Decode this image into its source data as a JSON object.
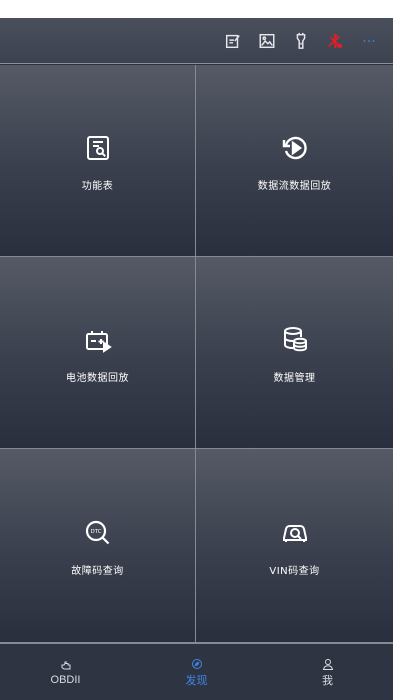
{
  "toolbar": {
    "icons": [
      "edit-note-icon",
      "image-icon",
      "flashlight-icon",
      "bluetooth-off-icon",
      "more-icon"
    ],
    "colors": {
      "bluetooth_off": "#e21f26",
      "more": "#3f86e8"
    }
  },
  "tiles": [
    {
      "label": "功能表",
      "icon": "function-list-icon"
    },
    {
      "label": "数据流数据回放",
      "icon": "replay-icon"
    },
    {
      "label": "电池数据回放",
      "icon": "battery-replay-icon"
    },
    {
      "label": "数据管理",
      "icon": "database-icon"
    },
    {
      "label": "故障码查询",
      "icon": "dtc-search-icon"
    },
    {
      "label": "VIN码查询",
      "icon": "vin-search-icon"
    }
  ],
  "bottom_nav": [
    {
      "label": "OBDII",
      "icon": "engine-icon",
      "active": false
    },
    {
      "label": "发现",
      "icon": "discover-icon",
      "active": true
    },
    {
      "label": "我",
      "icon": "user-icon",
      "active": false
    }
  ],
  "colors": {
    "accent": "#3f86e8",
    "background": "#2c3140"
  }
}
